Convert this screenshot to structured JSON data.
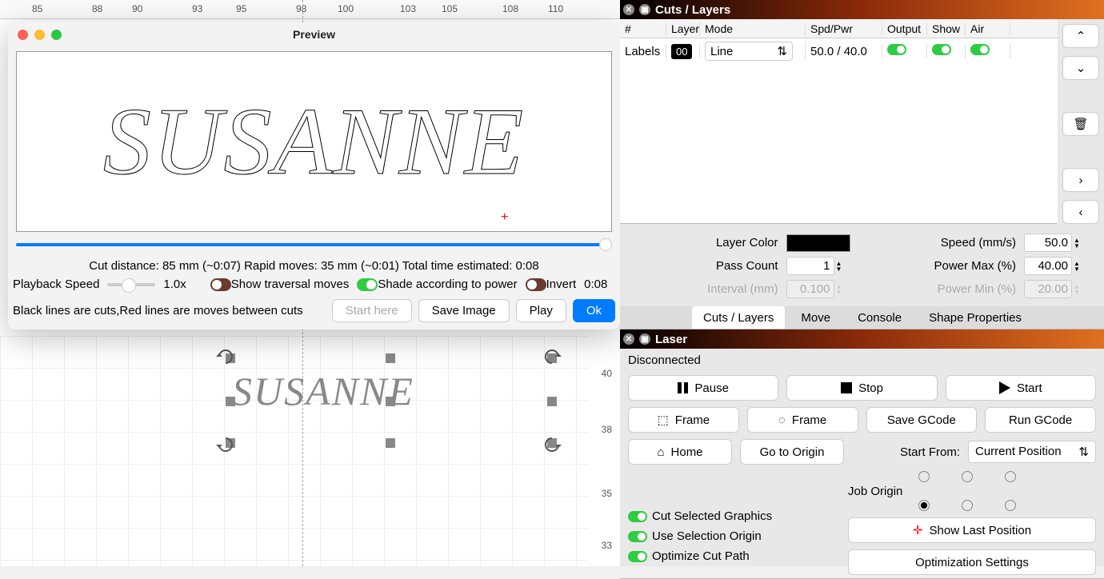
{
  "canvas": {
    "h_ruler": [
      "85",
      "88",
      "90",
      "93",
      "95",
      "98",
      "100",
      "103",
      "105",
      "108",
      "110"
    ],
    "v_ruler": [
      "40",
      "38",
      "35",
      "33"
    ],
    "text": "SUSANNE"
  },
  "preview": {
    "title": "Preview",
    "text": "SUSANNE",
    "stats": "Cut distance: 85 mm (~0:07)   Rapid moves: 35 mm (~0:01)   Total time estimated: 0:08",
    "playback_label": "Playback Speed",
    "playback_value": "1.0x",
    "show_traversal": "Show traversal moves",
    "shade_power": "Shade according to power",
    "invert": "Invert",
    "time": "0:08",
    "hint": "Black lines are cuts,Red lines are moves between cuts",
    "start_here": "Start here",
    "save_image": "Save Image",
    "play": "Play",
    "ok": "Ok"
  },
  "cuts": {
    "title": "Cuts / Layers",
    "cols": {
      "hash": "#",
      "layer": "Layer",
      "mode": "Mode",
      "spd": "Spd/Pwr",
      "out": "Output",
      "show": "Show",
      "air": "Air"
    },
    "row": {
      "label": "Labels",
      "num": "00",
      "mode": "Line",
      "spd": "50.0 / 40.0"
    },
    "props": {
      "layer_color": "Layer Color",
      "speed": "Speed (mm/s)",
      "pass": "Pass Count",
      "pmax": "Power Max (%)",
      "interval": "Interval (mm)",
      "pmin": "Power Min (%)",
      "speed_v": "50.0",
      "pass_v": "1",
      "pmax_v": "40.00",
      "interval_v": "0.100",
      "pmin_v": "20.00"
    }
  },
  "tabs": {
    "cuts": "Cuts / Layers",
    "move": "Move",
    "console": "Console",
    "shape": "Shape Properties"
  },
  "laser": {
    "title": "Laser",
    "status": "Disconnected",
    "pause": "Pause",
    "stop": "Stop",
    "start": "Start",
    "frame1": "Frame",
    "frame2": "Frame",
    "save_g": "Save GCode",
    "run_g": "Run GCode",
    "home": "Home",
    "goto": "Go to Origin",
    "start_from": "Start From:",
    "start_from_v": "Current Position",
    "job_origin": "Job Origin",
    "cut_sel": "Cut Selected Graphics",
    "use_sel": "Use Selection Origin",
    "opt_path": "Optimize Cut Path",
    "show_last": "Show Last Position",
    "opt_set": "Optimization Settings"
  }
}
